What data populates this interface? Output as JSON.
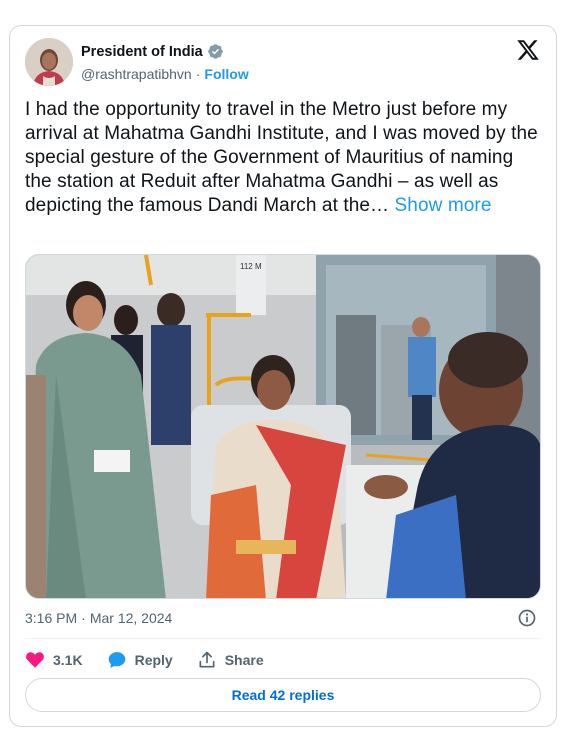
{
  "author": {
    "display_name": "President of India",
    "handle": "@rashtrapatibhvn",
    "separator": "·",
    "follow_label": "Follow",
    "verified_color": "#829aab"
  },
  "tweet": {
    "text": "I had the opportunity to travel in the Metro just before my arrival at Mahatma Gandhi Institute, and I was moved by the special gesture of the Government of Mauritius of naming the station at Reduit after Mahatma Gandhi – as well as depicting the famous Dandi March at the…",
    "show_more_label": "Show more",
    "time": "3:16 PM",
    "separator": "·",
    "date": "Mar 12, 2024"
  },
  "photo": {
    "sign_text": "112 M"
  },
  "actions": {
    "like_count": "3.1K",
    "reply_label": "Reply",
    "share_label": "Share",
    "read_replies_label": "Read 42 replies"
  },
  "colors": {
    "accent": "#1d9bf0",
    "like": "#f91880",
    "reply_icon": "#1d9bf0",
    "secondary_text": "#536471",
    "border": "#cfd9de"
  },
  "icons": [
    "verified-badge-icon",
    "x-logo-icon",
    "info-icon",
    "heart-icon",
    "reply-bubble-icon",
    "share-icon"
  ]
}
